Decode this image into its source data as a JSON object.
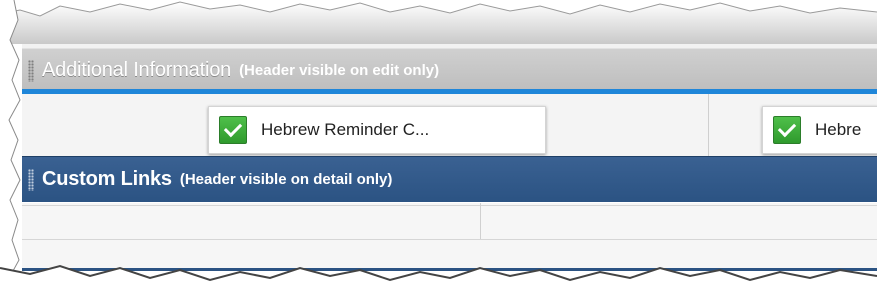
{
  "sections": {
    "additional": {
      "title": "Additional Information",
      "note": "(Header visible on edit only)"
    },
    "custom_links": {
      "title": "Custom Links",
      "note": "(Header visible on detail only)"
    }
  },
  "fields": [
    {
      "label": "Hebrew Reminder C...",
      "checked": true
    },
    {
      "label": "Hebre",
      "checked": true
    }
  ],
  "colors": {
    "additional_header": "#c4c4c4",
    "custom_header": "#2b5383",
    "accent_rule": "#1f86d9",
    "check_green": "#3aa638"
  },
  "icons": [
    "drag-grip-icon",
    "checkbox-checked-icon"
  ]
}
